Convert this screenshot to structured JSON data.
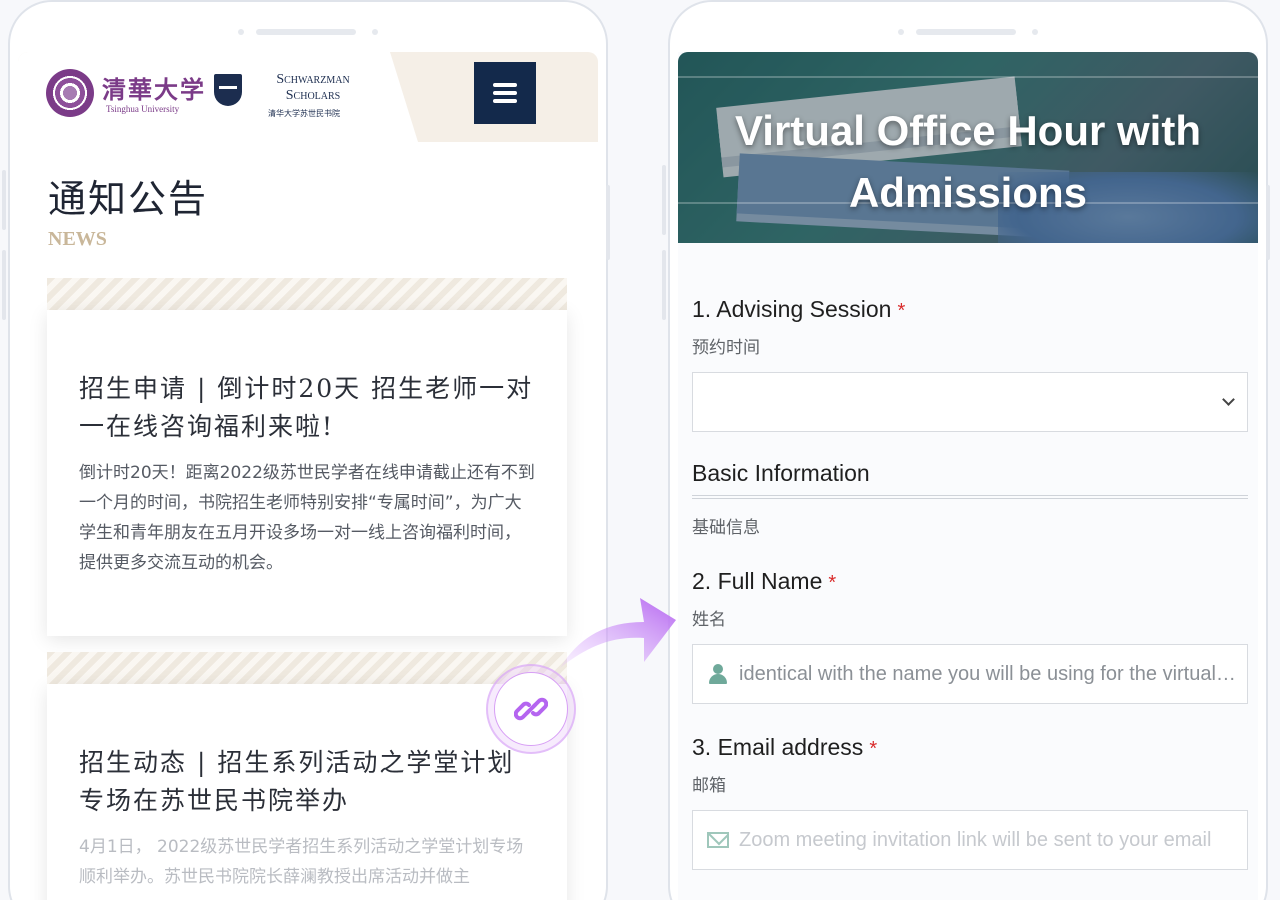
{
  "left": {
    "brand_cn": "清華大学",
    "brand_en": "Tsinghua University",
    "schwarzman_title": "Schwarzman Scholars",
    "schwarzman_sub": "清华大学苏世民书院",
    "page_title": "通知公告",
    "page_subtitle": "NEWS",
    "cards": [
      {
        "title": "招生申请 | 倒计时20天 招生老师一对一在线咨询福利来啦!",
        "body": "倒计时20天！距离2022级苏世民学者在线申请截止还有不到一个月的时间，书院招生老师特别安排“专属时间”，为广大学生和青年朋友在五月开设多场一对一线上咨询福利时间，提供更多交流互动的机会。"
      },
      {
        "title": "招生动态 | 招生系列活动之学堂计划专场在苏世民书院举办",
        "body": "4月1日， 2022级苏世民学者招生系列活动之学堂计划专场顺利举办。苏世民书院院长薛澜教授出席活动并做主"
      }
    ]
  },
  "right": {
    "banner_title": "Virtual Office Hour with Admissions",
    "q1_label": "1. Advising Session",
    "q1_sub": "预约时间",
    "required_mark": "*",
    "section_title": "Basic Information",
    "section_sub": "基础信息",
    "q2_label": "2. Full Name",
    "q2_sub": "姓名",
    "q2_placeholder": "identical with the name you will be using for the virtual office hour",
    "q3_label": "3. Email address",
    "q3_sub": "邮箱",
    "q3_placeholder": "Zoom meeting invitation link will be sent to your email"
  },
  "icons": {
    "menu": "hamburger-icon",
    "select": "chevron-down-icon",
    "name_field": "user-icon",
    "email_field": "envelope-icon",
    "link": "link-icon",
    "arrow": "curved-arrow-icon"
  },
  "colors": {
    "navy": "#13294b",
    "purple_brand": "#7b3b88",
    "news_gold": "#c9b79a",
    "required_red": "#d92b2b",
    "arrow_purple": "#b565f0"
  }
}
